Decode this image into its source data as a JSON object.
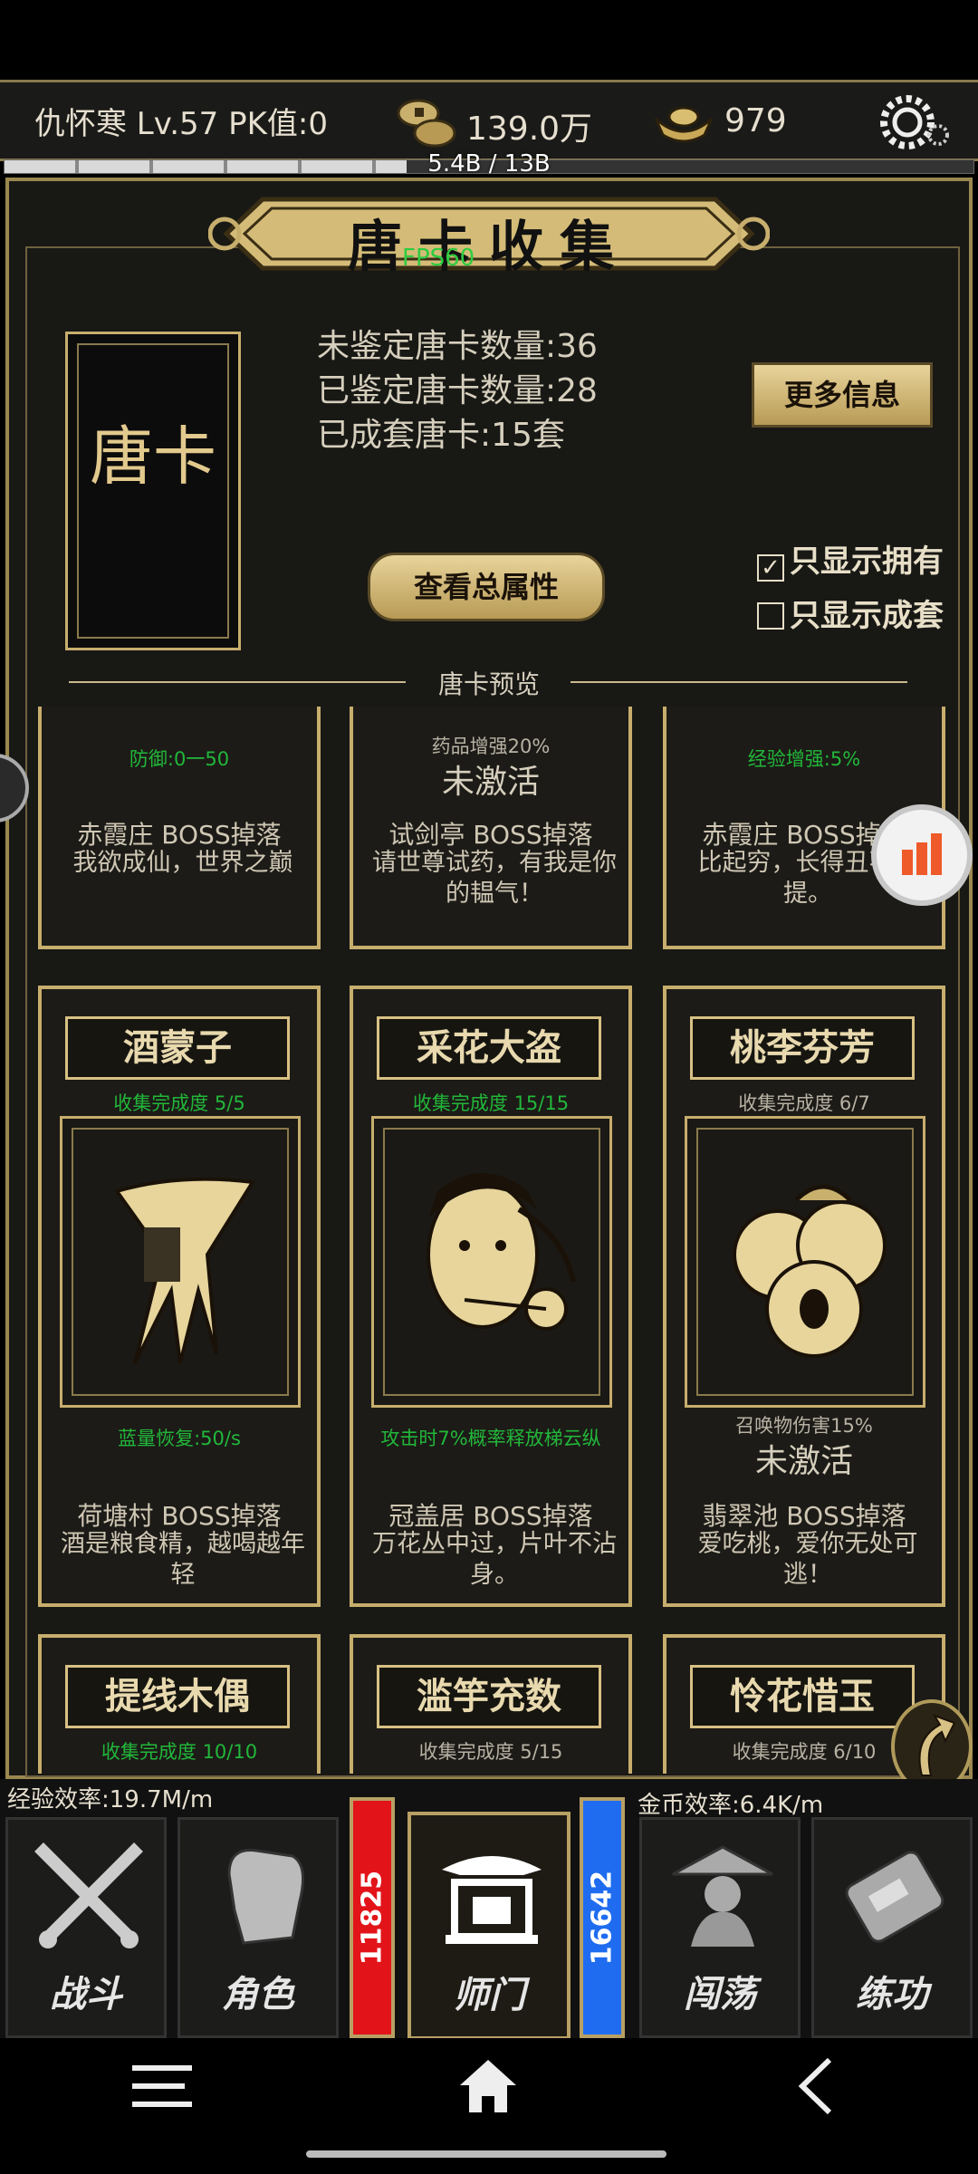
{
  "hud": {
    "player": "仇怀寒 Lv.57 PK值:0",
    "coins": "139.0万",
    "ingots": "979",
    "exp_text": "5.4B / 13B",
    "exp_progress": 0.415
  },
  "header": {
    "title": "唐卡收集",
    "fps": "FPS60"
  },
  "deck": {
    "label": "唐卡"
  },
  "stats": [
    "未鉴定唐卡数量:36",
    "已鉴定唐卡数量:28",
    "已成套唐卡:15套"
  ],
  "buttons": {
    "more_info": "更多信息",
    "total_attr": "查看总属性"
  },
  "filters": {
    "only_owned": "只显示拥有",
    "only_owned_checked": true,
    "only_sets": "只显示成套",
    "only_sets_checked": false
  },
  "preview_label": "唐卡预览",
  "cards_top": [
    {
      "effect": "防御:0一50",
      "effect_active": true,
      "source": "赤霞庄 BOSS掉落",
      "desc": "我欲成仙，世界之巅"
    },
    {
      "effect": "药品增强20%",
      "effect_active": false,
      "inactive": "未激活",
      "source": "试剑亭 BOSS掉落",
      "desc": "请世尊试药，有我是你的韫气！"
    },
    {
      "effect": "经验增强:5%",
      "effect_active": true,
      "source": "赤霞庄 BOSS掉落",
      "desc": "比起穷，长得丑不值提。"
    }
  ],
  "cards_mid": [
    {
      "title": "酒蒙子",
      "progress": "收集完成度  5/5",
      "complete": true,
      "art": "wine-vessel-art",
      "effect": "蓝量恢复:50/s",
      "effect_active": true,
      "source": "荷塘村 BOSS掉落",
      "desc": "酒是粮食精，越喝越年轻"
    },
    {
      "title": "采花大盗",
      "progress": "收集完成度  15/15",
      "complete": true,
      "art": "flower-thief-art",
      "effect": "攻击时7%概率释放梯云纵",
      "effect_active": true,
      "source": "冠盖居 BOSS掉落",
      "desc": "万花丛中过，片叶不沾身。"
    },
    {
      "title": "桃李芬芳",
      "progress": "收集完成度  6/7",
      "complete": false,
      "art": "peaches-art",
      "effect": "召唤物伤害15%",
      "effect_active": false,
      "inactive": "未激活",
      "source": "翡翠池 BOSS掉落",
      "desc": "爱吃桃，爱你无处可逃！"
    }
  ],
  "cards_bottom": [
    {
      "title": "提线木偶",
      "progress": "收集完成度  10/10",
      "complete": true
    },
    {
      "title": "滥竽充数",
      "progress": "收集完成度  5/15",
      "complete": false
    },
    {
      "title": "怜花惜玉",
      "progress": "收集完成度  6/10",
      "complete": false
    }
  ],
  "efficiency": {
    "exp": "经验效率:19.7M/m",
    "gold": "金币效率:6.4K/m"
  },
  "bars": {
    "red": "11825",
    "blue": "16642"
  },
  "nav": {
    "battle": "战斗",
    "role": "角色",
    "sect": "师门",
    "roam": "闯荡",
    "train": "练功"
  },
  "colors": {
    "gold": "#c7ae6d",
    "panel": "#181815",
    "active_green": "#22b73a",
    "red_bar": "#e2141a",
    "blue_bar": "#1f6cf0"
  }
}
